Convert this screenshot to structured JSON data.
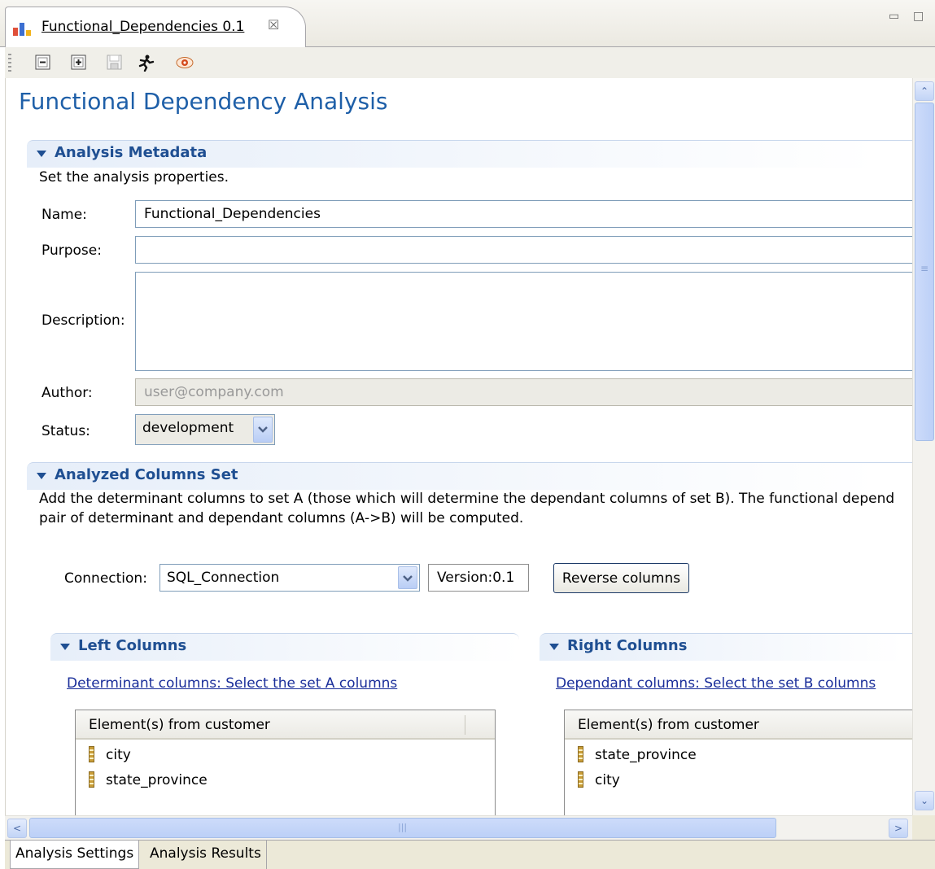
{
  "tab": {
    "title": "Functional_Dependencies 0.1",
    "close_glyph": "☒",
    "icon": "chart-icon"
  },
  "window_controls": {
    "minimize_glyph": "▭",
    "maximize_glyph": "□"
  },
  "toolbar": {
    "buttons": [
      "collapse-all-icon",
      "expand-all-icon",
      "save-icon",
      "run-icon",
      "preview-icon"
    ]
  },
  "page": {
    "title": "Functional Dependency Analysis"
  },
  "metadata_section": {
    "title": "Analysis Metadata",
    "description": "Set the analysis properties.",
    "name_label": "Name:",
    "name_value": "Functional_Dependencies",
    "purpose_label": "Purpose:",
    "purpose_value": "",
    "description_label": "Description:",
    "description_value": "",
    "author_label": "Author:",
    "author_placeholder": "user@company.com",
    "status_label": "Status:",
    "status_value": "development"
  },
  "columns_section": {
    "title": "Analyzed Columns Set",
    "description_line1": "Add the determinant columns to set A (those which will determine the dependant columns of set B). The functional depend",
    "description_line2": "pair of determinant and dependant columns (A->B) will be computed.",
    "connection_label": "Connection:",
    "connection_value": "SQL_Connection",
    "version_label": "Version:0.1",
    "reverse_button": "Reverse columns"
  },
  "left_columns": {
    "title": "Left Columns",
    "link": "Determinant columns: Select the set A columns",
    "table_header": "Element(s) from customer",
    "rows": [
      "city",
      "state_province"
    ]
  },
  "right_columns": {
    "title": "Right Columns",
    "link": "Dependant columns: Select the set B columns",
    "table_header": "Element(s) from customer",
    "rows": [
      "state_province",
      "city"
    ]
  },
  "scrollbar": {
    "grip_glyph": "|||",
    "vgrip_glyph": "≡",
    "up_glyph": "⌃",
    "down_glyph": "⌄",
    "left_glyph": "<",
    "right_glyph": ">"
  },
  "bottom_tabs": [
    "Analysis Settings",
    "Analysis Results"
  ]
}
